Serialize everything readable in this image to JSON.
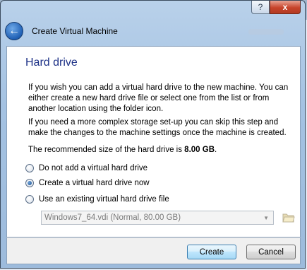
{
  "window": {
    "title": "Create Virtual Machine",
    "caption": {
      "help": "?",
      "close": "x"
    }
  },
  "page": {
    "heading": "Hard drive",
    "paragraph1": "If you wish you can add a virtual hard drive to the new machine. You can either create a new hard drive file or select one from the list or from another location using the folder icon.",
    "paragraph2": "If you need a more complex storage set-up you can skip this step and make the changes to the machine settings once the machine is created.",
    "recommended_prefix": "The recommended size of the hard drive is ",
    "recommended_size": "8.00 GB",
    "recommended_suffix": "."
  },
  "options": [
    {
      "label": "Do not add a virtual hard drive",
      "checked": false
    },
    {
      "label": "Create a virtual hard drive now",
      "checked": true
    },
    {
      "label": "Use an existing virtual hard drive file",
      "checked": false
    }
  ],
  "existing_disk": {
    "value": "Windows7_64.vdi (Normal, 80.00 GB)",
    "enabled": false
  },
  "buttons": {
    "create": "Create",
    "cancel": "Cancel"
  },
  "icons": {
    "back": "back-arrow-icon",
    "folder": "folder-open-icon",
    "dropdown": "chevron-down-icon"
  },
  "colors": {
    "heading": "#1e3287",
    "frame": "#a4c2e2",
    "close": "#c7442b"
  }
}
